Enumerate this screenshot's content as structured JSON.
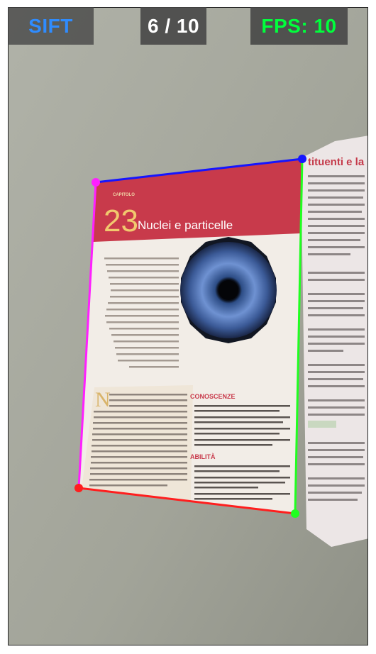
{
  "hud": {
    "algorithm_label": "SIFT",
    "frame_counter": "6 / 10",
    "fps_label": "FPS: 10",
    "colors": {
      "algorithm": "#2f8cff",
      "counter": "#ffffff",
      "fps": "#00ff3c"
    }
  },
  "detection": {
    "edge_colors": {
      "top": "#1515ff",
      "right": "#20ff20",
      "bottom": "#ff1e1e",
      "left": "#ff20ff"
    },
    "corner_colors": {
      "top_left": "#ff20ff",
      "top_right": "#1515ff",
      "bottom_right": "#20ff20",
      "bottom_left": "#ff1e1e"
    }
  },
  "book_page": {
    "chapter_tag": "CAPITOLO",
    "chapter_number": "23",
    "chapter_title": "Nuclei e particelle",
    "box_heading_1": "CONOSCENZE",
    "box_heading_2": "ABILITÀ",
    "right_page_heading": "tituenti e la str"
  }
}
